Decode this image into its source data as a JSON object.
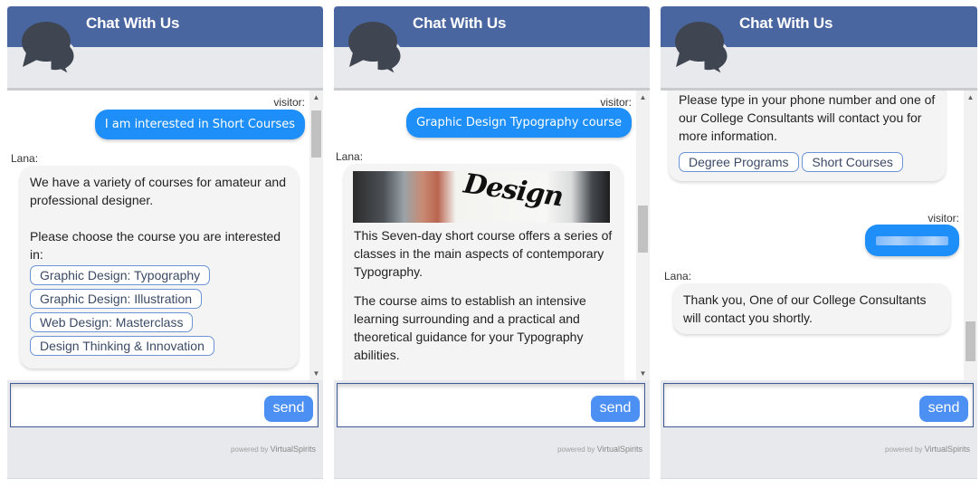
{
  "colors": {
    "header": "#4a66a0",
    "visitor_bubble": "#1e8ff8",
    "send_button": "#4d90f4",
    "option_border": "#6a94d6"
  },
  "panels": [
    {
      "header_title": "Chat With Us",
      "icon": "chat-bubbles-icon",
      "messages": [
        {
          "sender": "visitor:",
          "text": "I am interested in Short Courses"
        },
        {
          "sender": "Lana:",
          "paragraphs": [
            "We have a variety of courses for amateur and professional designer.",
            "Please choose the course you are interested in:"
          ],
          "options": [
            "Graphic Design: Typography",
            "Graphic Design: Illustration",
            "Web Design: Masterclass",
            "Design Thinking & Innovation"
          ]
        }
      ],
      "input": {
        "value": "",
        "send_label": "send"
      },
      "powered_by": {
        "prefix": "powered by",
        "brand": "VirtualSpirits"
      }
    },
    {
      "header_title": "Chat With Us",
      "icon": "chat-bubbles-icon",
      "messages": [
        {
          "sender": "visitor:",
          "text": "Graphic Design Typography course"
        },
        {
          "sender": "Lana:",
          "image_text": "Design",
          "paragraphs": [
            "This Seven-day short course offers a series of classes in the main aspects of contemporary Typography.",
            "The course aims to establish an intensive learning surrounding and a practical and theoretical guidance for your Typography abilities."
          ]
        }
      ],
      "input": {
        "value": "",
        "send_label": "send"
      },
      "powered_by": {
        "prefix": "powered by",
        "brand": "VirtualSpirits"
      }
    },
    {
      "header_title": "Chat With Us",
      "icon": "chat-bubbles-icon",
      "messages": [
        {
          "sender": "Lana:",
          "paragraphs": [
            "Please type in your phone number and one of our College Consultants will contact you for more information."
          ],
          "options": [
            "Degree Programs",
            "Short Courses"
          ]
        },
        {
          "sender": "visitor:",
          "text": "[redacted phone number]"
        },
        {
          "sender": "Lana:",
          "paragraphs": [
            "Thank you, One of our College Consultants will contact you shortly."
          ]
        }
      ],
      "input": {
        "value": "",
        "send_label": "send"
      },
      "powered_by": {
        "prefix": "powered by",
        "brand": "VirtualSpirits"
      }
    }
  ]
}
